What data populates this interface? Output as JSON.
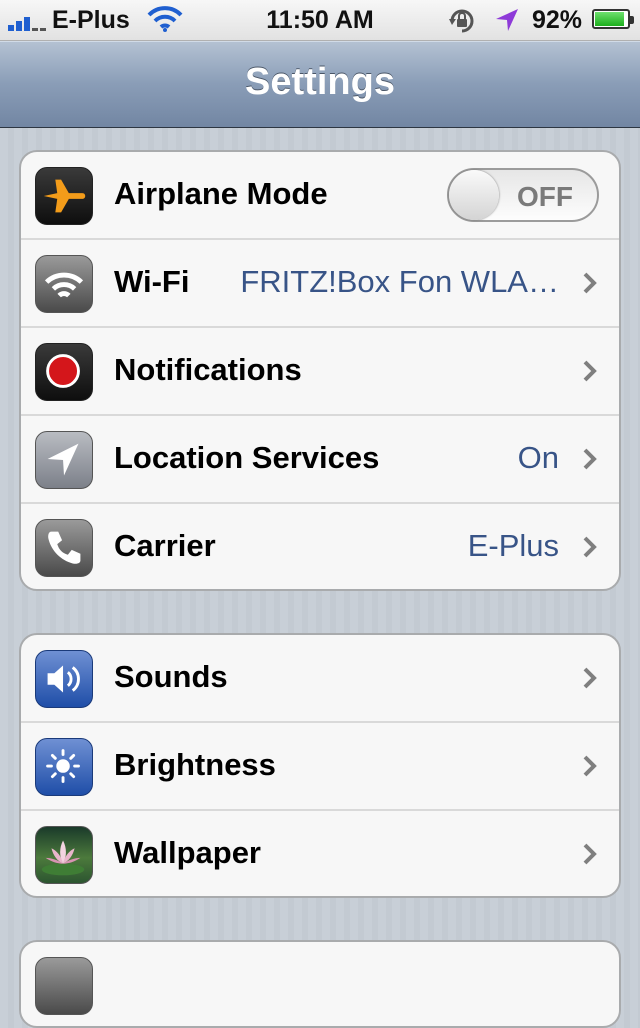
{
  "status_bar": {
    "carrier": "E-Plus",
    "time": "11:50 AM",
    "battery_percent": "92%",
    "battery_level": 0.92,
    "signal_icon": "signal-bars-icon",
    "wifi_icon": "wifi-icon",
    "lock_icon": "rotation-lock-icon",
    "location_icon": "location-arrow-icon"
  },
  "nav": {
    "title": "Settings"
  },
  "groups": [
    {
      "rows": [
        {
          "label": "Airplane Mode",
          "icon": "airplane-icon",
          "toggle": "OFF"
        },
        {
          "label": "Wi-Fi",
          "icon": "wifi-icon",
          "value": "FRITZ!Box Fon WLA…"
        },
        {
          "label": "Notifications",
          "icon": "notifications-icon"
        },
        {
          "label": "Location Services",
          "icon": "location-icon",
          "value": "On"
        },
        {
          "label": "Carrier",
          "icon": "phone-icon",
          "value": "E-Plus"
        }
      ]
    },
    {
      "rows": [
        {
          "label": "Sounds",
          "icon": "speaker-icon"
        },
        {
          "label": "Brightness",
          "icon": "brightness-icon"
        },
        {
          "label": "Wallpaper",
          "icon": "wallpaper-icon"
        }
      ]
    }
  ],
  "colors": {
    "value_text": "#385487",
    "nav_bar": "#8a9db7"
  }
}
